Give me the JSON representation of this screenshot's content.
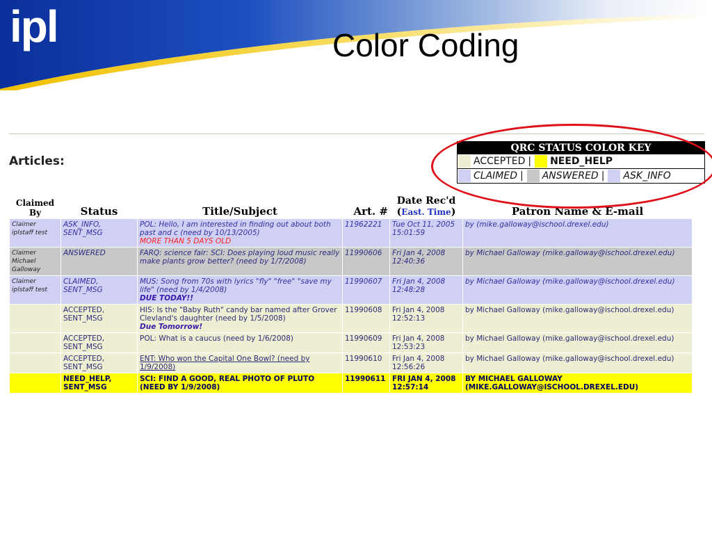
{
  "logo": "ipl",
  "slide_title": "Color Coding",
  "articles_label": "Articles:",
  "key": {
    "title": "QRC STATUS COLOR KEY",
    "row1": [
      {
        "label": "ACCEPTED",
        "sep": "|",
        "color": "#eeeed2"
      },
      {
        "label": "NEED_HELP",
        "sep": "",
        "color": "#ffff00"
      }
    ],
    "row2": [
      {
        "label": "CLAIMED",
        "sep": "|",
        "color": "#d0d0f5"
      },
      {
        "label": "ANSWERED",
        "sep": "|",
        "color": "#c8c8c8"
      },
      {
        "label": "ASK_INFO",
        "sep": "",
        "color": "#d0d0f5"
      }
    ]
  },
  "table": {
    "headers": {
      "claimed_by_1": "Claimed",
      "claimed_by_2": "By",
      "status": "Status",
      "title": "Title/Subject",
      "art": "Art. #",
      "date_1": "Date Rec'd",
      "date_2_open": "(",
      "date_2_link": "East. Time",
      "date_2_close": ")",
      "patron": "Patron Name & E-mail"
    },
    "rows": [
      {
        "claimer": "Claimer iplstaff test",
        "status": "ASK_INFO, SENT_MSG",
        "title": "POL: Hello, I am interested in finding out about both past and c (need by 10/13/2005)",
        "note": "MORE THAN 5 DAYS OLD",
        "art": "11962221",
        "date": "Tue Oct 11, 2005 15:01:59",
        "patron": "by (mike.galloway@ischool.drexel.edu)"
      },
      {
        "claimer": "Claimer Michael Galloway",
        "status": "ANSWERED",
        "title": "FARQ: science fair: SCI: Does playing loud music really make plants grow better? (need by 1/7/2008)",
        "note": "",
        "art": "11990606",
        "date": "Fri Jan 4, 2008 12:40:36",
        "patron": "by Michael Galloway (mike.galloway@ischool.drexel.edu)"
      },
      {
        "claimer": "Claimer iplstaff test",
        "status": "CLAIMED, SENT_MSG",
        "title": "MUS: Song from 70s with lyrics \"fly\" \"free\" \"save my life\" (need by 1/4/2008)",
        "note": "DUE TODAY!!",
        "art": "11990607",
        "date": "Fri Jan 4, 2008 12:48:28",
        "patron": "by Michael Galloway (mike.galloway@ischool.drexel.edu)"
      },
      {
        "claimer": "",
        "status": "ACCEPTED, SENT_MSG",
        "title": "HIS: Is the \"Baby Ruth\" candy bar named after Grover Clevland's daughter (need by 1/5/2008)",
        "note": "Due Tomorrow!",
        "art": "11990608",
        "date": "Fri Jan 4, 2008 12:52:13",
        "patron": "by Michael Galloway (mike.galloway@ischool.drexel.edu)"
      },
      {
        "claimer": "",
        "status": "ACCEPTED, SENT_MSG",
        "title": "POL: What is a caucus (need by 1/6/2008)",
        "note": "",
        "art": "11990609",
        "date": "Fri Jan 4, 2008 12:53:23",
        "patron": "by Michael Galloway (mike.galloway@ischool.drexel.edu)"
      },
      {
        "claimer": "",
        "status": "ACCEPTED, SENT_MSG",
        "title": "ENT: Who won the Capital One Bowl? (need by 1/9/2008)",
        "note": "",
        "art": "11990610",
        "date": "Fri Jan 4, 2008 12:56:26",
        "patron": "by Michael Galloway (mike.galloway@ischool.drexel.edu)"
      },
      {
        "claimer": "",
        "status": "NEED_HELP, SENT_MSG",
        "title": "SCI: FIND A GOOD, REAL PHOTO OF PLUTO (NEED BY 1/9/2008)",
        "note": "",
        "art": "11990611",
        "date": "FRI JAN 4, 2008 12:57:14",
        "patron": "BY MICHAEL GALLOWAY (MIKE.GALLOWAY@ISCHOOL.DREXEL.EDU)"
      }
    ]
  },
  "colors": {
    "accepted": "#eeeed2",
    "need_help": "#ffff00",
    "claimed": "#d0d0f5",
    "answered": "#c8c8c8",
    "ask_info": "#d0d0f5",
    "highlight_oval": "#e0101a"
  }
}
